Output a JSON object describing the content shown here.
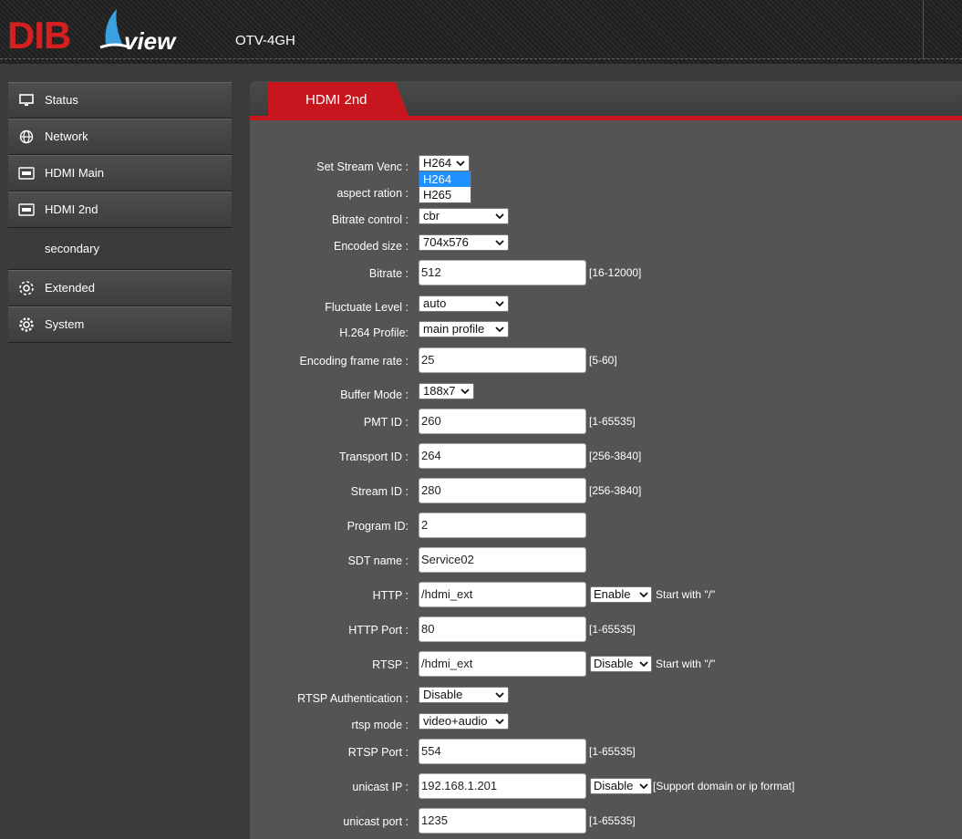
{
  "header": {
    "logo_dib": "DIB",
    "logo_view": "view",
    "model": "OTV-4GH"
  },
  "sidebar": {
    "items": [
      {
        "label": "Status",
        "icon": "monitor-icon"
      },
      {
        "label": "Network",
        "icon": "globe-icon"
      },
      {
        "label": "HDMI Main",
        "icon": "hdmi-icon"
      },
      {
        "label": "HDMI 2nd",
        "icon": "hdmi-icon"
      }
    ],
    "sub": {
      "label": "secondary"
    },
    "items2": [
      {
        "label": "Extended",
        "icon": "extended-gear-icon"
      },
      {
        "label": "System",
        "icon": "gear-icon"
      }
    ]
  },
  "tab": {
    "label": "HDMI 2nd"
  },
  "form": {
    "venc": {
      "label": "Set Stream Venc :",
      "value": "H264",
      "options": [
        "H264",
        "H265"
      ],
      "highlighted": "H264"
    },
    "aspect": {
      "label": "aspect ration :"
    },
    "bitrate_control": {
      "label": "Bitrate control :",
      "value": "cbr"
    },
    "encoded_size": {
      "label": "Encoded size :",
      "value": "704x576"
    },
    "bitrate": {
      "label": "Bitrate :",
      "value": "512",
      "hint": "[16-12000]"
    },
    "fluctuate": {
      "label": "Fluctuate Level :",
      "value": "auto"
    },
    "profile": {
      "label": "H.264 Profile:",
      "value": "main profile"
    },
    "frame_rate": {
      "label": "Encoding frame rate :",
      "value": "25",
      "hint": "[5-60]"
    },
    "buffer_mode": {
      "label": "Buffer Mode :",
      "value": "188x7"
    },
    "pmt_id": {
      "label": "PMT ID :",
      "value": "260",
      "hint": "[1-65535]"
    },
    "transport_id": {
      "label": "Transport ID :",
      "value": "264",
      "hint": "[256-3840]"
    },
    "stream_id": {
      "label": "Stream ID :",
      "value": "280",
      "hint": "[256-3840]"
    },
    "program_id": {
      "label": "Program ID:",
      "value": "2"
    },
    "sdt_name": {
      "label": "SDT name :",
      "value": "Service02"
    },
    "http": {
      "label": "HTTP :",
      "value": "/hdmi_ext",
      "mode": "Enable",
      "note": "Start with \"/\""
    },
    "http_port": {
      "label": "HTTP Port :",
      "value": "80",
      "hint": "[1-65535]"
    },
    "rtsp": {
      "label": "RTSP :",
      "value": "/hdmi_ext",
      "mode": "Disable",
      "note": "Start with \"/\""
    },
    "rtsp_auth": {
      "label": "RTSP Authentication :",
      "value": "Disable"
    },
    "rtsp_mode": {
      "label": "rtsp mode :",
      "value": "video+audio"
    },
    "rtsp_port": {
      "label": "RTSP Port :",
      "value": "554",
      "hint": "[1-65535]"
    },
    "unicast_ip": {
      "label": "unicast IP :",
      "value": "192.168.1.201",
      "mode": "Disable",
      "note": "[Support domain or ip format]"
    },
    "unicast_port": {
      "label": "unicast port :",
      "value": "1235",
      "hint": "[1-65535]"
    }
  },
  "colors": {
    "accent": "#c8161e",
    "highlight": "#1e90ff",
    "panel": "#545454",
    "background": "#3b3b3b"
  }
}
